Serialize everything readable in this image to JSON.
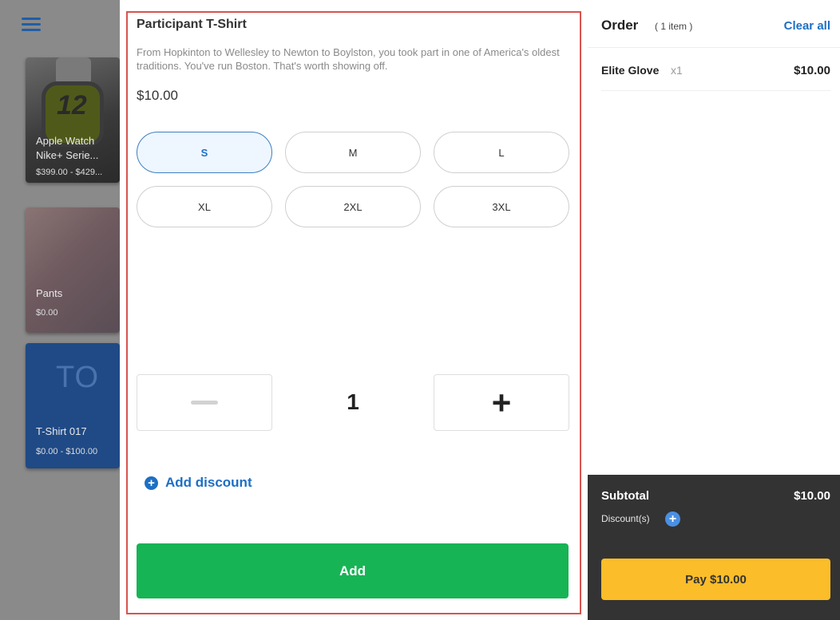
{
  "products": [
    {
      "name": "Apple Watch Nike+ Serie...",
      "price": "$399.00 - $429...",
      "watch_number": "12"
    },
    {
      "name": "Pants",
      "price": "$0.00"
    },
    {
      "name": "T-Shirt 017",
      "price": "$0.00 - $100.00",
      "initials": "TO"
    }
  ],
  "modal": {
    "title": "Participant T-Shirt",
    "description": "From Hopkinton to Wellesley to Newton to Boylston, you took part in one of America's oldest traditions. You've run Boston. That's worth showing off.",
    "price": "$10.00",
    "sizes": [
      "S",
      "M",
      "L",
      "XL",
      "2XL",
      "3XL"
    ],
    "selected_size": "S",
    "quantity": "1",
    "quantity_minus": "—",
    "quantity_plus": "+",
    "add_discount": "Add discount",
    "add_button": "Add"
  },
  "order": {
    "title": "Order",
    "count": "( 1 item )",
    "clear_all": "Clear all",
    "items": [
      {
        "name": "Elite Glove",
        "qty": "x1",
        "price": "$10.00"
      }
    ],
    "subtotal_label": "Subtotal",
    "subtotal_value": "$10.00",
    "discounts_label": "Discount(s)",
    "pay_button": "Pay $10.00"
  },
  "colors": {
    "accent_blue": "#1d6fc4",
    "add_green": "#17b455",
    "pay_yellow": "#fbbd29",
    "highlight_red": "#d9534f"
  }
}
